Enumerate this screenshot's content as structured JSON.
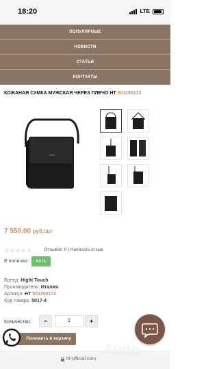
{
  "status_bar": {
    "time": "18:20",
    "network": "LTE"
  },
  "menu": {
    "items": [
      "ПОПУЛЯРНЫЕ",
      "НОВОСТИ",
      "СТАТЬИ",
      "КОНТАКТЫ"
    ]
  },
  "product": {
    "title": "КОЖАНАЯ СУМКА МУЖСКАЯ ЧЕРЕЗ ПЛЕЧО HT",
    "sku_link": "001150174",
    "price": "7 550.00",
    "price_unit": "руб./шт",
    "reviews_text": "Отзывов: 0",
    "reviews_separator": "|",
    "write_review": "Написать отзыв",
    "stock_label": "В наличии:",
    "stock_badge": "есть",
    "specs": {
      "brand_label": "Бренд:",
      "brand": "Hight Touch",
      "maker_label": "Производитель:",
      "maker": "Италия",
      "article_label": "Артикул:",
      "article_prefix": "HT",
      "article_sku": "001150174",
      "code_label": "Код товара:",
      "code": "5017-4"
    },
    "quantity_label": "Количество:",
    "quantity_value": "1",
    "minus_label": "−",
    "plus_label": "+",
    "add_to_cart": "Положить в корзину"
  },
  "browser": {
    "url": "ht-official.com"
  },
  "watermark": "Avito",
  "colors": {
    "menu_bg": "#8a7463",
    "accent": "#c98b63",
    "stock": "#6ec26f",
    "chat_button": "#7c5646"
  }
}
